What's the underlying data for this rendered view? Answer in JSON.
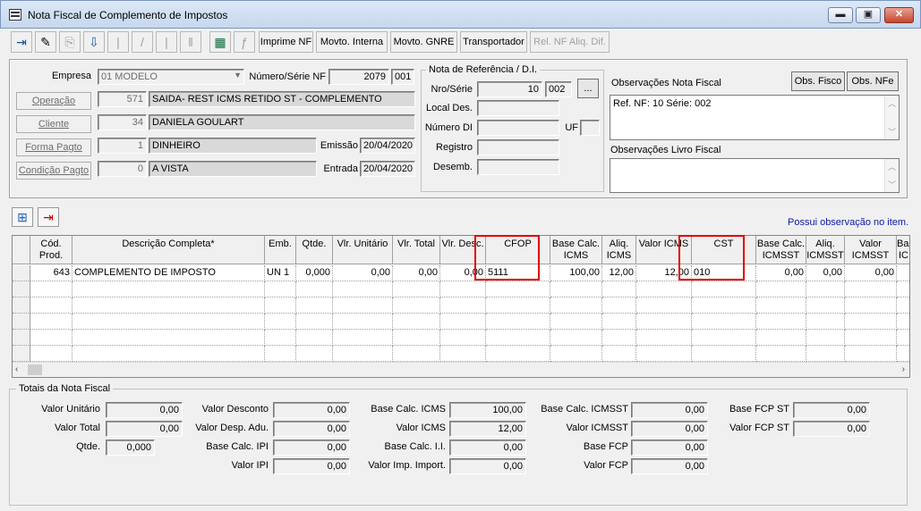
{
  "window": {
    "title": "Nota Fiscal de Complemento de Impostos",
    "minimize": "▬",
    "maximize": "▣",
    "close": "✕"
  },
  "toolbar": {
    "imprime_nf": "Imprime NF",
    "movto_interna": "Movto. Interna",
    "movto_gnre": "Movto. GNRE",
    "transportador": "Transportador",
    "rel_nf_aliq": "Rel. NF Aliq. Dif."
  },
  "header": {
    "empresa_label": "Empresa",
    "empresa_value": "01 MODELO",
    "numero_serie_label": "Número/Série NF",
    "numero_value": "2079",
    "serie_value": "001",
    "operacao_button": "Operação",
    "operacao_code": "571",
    "operacao_desc": "SAIDA- REST ICMS RETIDO ST - COMPLEMENTO",
    "cliente_button": "Cliente",
    "cliente_code": "34",
    "cliente_desc": "DANIELA GOULART",
    "forma_pagto_button": "Forma Pagto",
    "forma_pagto_code": "1",
    "forma_pagto_desc": "DINHEIRO",
    "condicao_pagto_button": "Condição Pagto",
    "condicao_pagto_code": "0",
    "condicao_pagto_desc": "A VISTA",
    "emissao_label": "Emissão",
    "emissao_value": "20/04/2020",
    "entrada_label": "Entrada",
    "entrada_value": "20/04/2020"
  },
  "referencia": {
    "group_title": "Nota de Referência / D.I.",
    "nro_serie_label": "Nro/Série",
    "nro_value": "10",
    "serie_value": "002",
    "browse_button": "...",
    "local_des_label": "Local Des.",
    "numero_di_label": "Número DI",
    "uf_label": "UF",
    "registro_label": "Registro",
    "desemb_label": "Desemb."
  },
  "observacoes": {
    "nf_label": "Observações Nota Fiscal",
    "obs_fisco_button": "Obs. Fisco",
    "obs_nfe_button": "Obs. NFe",
    "nf_text": "Ref. NF: 10 Série: 002",
    "livro_label": "Observações Livro Fiscal",
    "possui_obs": "Possui observação no item."
  },
  "grid": {
    "headers": [
      "Cód.\nProd.",
      "Descrição Completa*",
      "Emb.",
      "Qtde.",
      "Vlr. Unitário",
      "Vlr. Total",
      "Vlr. Desc.",
      "CFOP",
      "Base Calc.\nICMS",
      "Aliq.\nICMS",
      "Valor ICMS",
      "CST",
      "Base Calc.\nICMSST",
      "Aliq.\nICMSST",
      "Valor\nICMSST",
      "Bas\nIC"
    ],
    "rows": [
      [
        "643",
        "COMPLEMENTO DE IMPOSTO",
        "UN  1",
        "0,000",
        "0,00",
        "0,00",
        "0,00",
        "5111",
        "100,00",
        "12,00",
        "12,00",
        "010",
        "0,00",
        "0,00",
        "0,00",
        ""
      ]
    ]
  },
  "totais": {
    "group_title": "Totais da Nota Fiscal",
    "valor_unitario_label": "Valor Unitário",
    "valor_unitario": "0,00",
    "valor_total_label": "Valor Total",
    "valor_total": "0,00",
    "qtde_label": "Qtde.",
    "qtde": "0,000",
    "valor_desconto_label": "Valor Desconto",
    "valor_desconto": "0,00",
    "valor_desp_label": "Valor Desp. Adu.",
    "valor_desp": "0,00",
    "base_ipi_label": "Base Calc. IPI",
    "base_ipi": "0,00",
    "valor_ipi_label": "Valor IPI",
    "valor_ipi": "0,00",
    "base_icms_label": "Base Calc. ICMS",
    "base_icms": "100,00",
    "valor_icms_label": "Valor ICMS",
    "valor_icms": "12,00",
    "base_ii_label": "Base Calc. I.I.",
    "base_ii": "0,00",
    "valor_imp_label": "Valor Imp. Import.",
    "valor_imp": "0,00",
    "base_icmsst_label": "Base Calc. ICMSST",
    "base_icmsst": "0,00",
    "valor_icmsst_label": "Valor ICMSST",
    "valor_icmsst": "0,00",
    "base_fcp_label": "Base FCP",
    "base_fcp": "0,00",
    "valor_fcp_label": "Valor FCP",
    "valor_fcp": "0,00",
    "base_fcp_st_label": "Base FCP ST",
    "base_fcp_st": "0,00",
    "valor_fcp_st_label": "Valor FCP ST",
    "valor_fcp_st": "0,00"
  }
}
